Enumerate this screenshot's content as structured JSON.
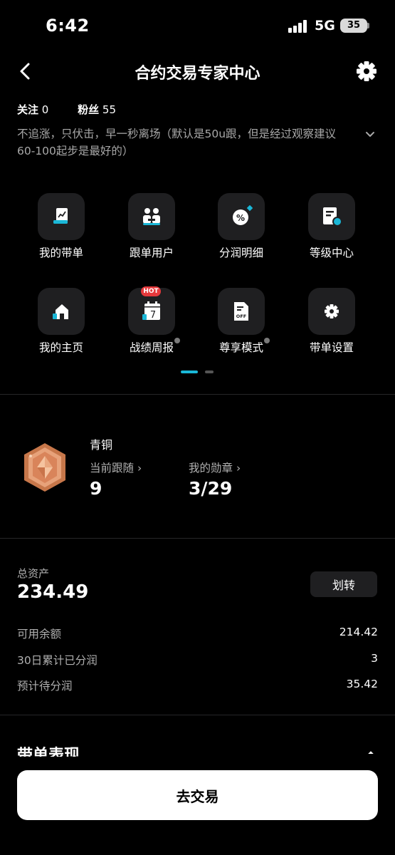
{
  "status_bar": {
    "time": "6:42",
    "network": "5G",
    "battery": "35"
  },
  "header": {
    "title": "合约交易专家中心"
  },
  "profile": {
    "follow_label": "关注",
    "follow_count": "0",
    "fans_label": "粉丝",
    "fans_count": "55",
    "bio": "不追涨，只伏击，早一秒离场（默认是50u跟，但是经过观察建议60-100起步是最好的）"
  },
  "grid": {
    "items": [
      {
        "label": "我的带单",
        "icon": "chart-doc-icon"
      },
      {
        "label": "跟单用户",
        "icon": "users-icon"
      },
      {
        "label": "分润明细",
        "icon": "percent-icon"
      },
      {
        "label": "等级中心",
        "icon": "level-icon"
      },
      {
        "label": "我的主页",
        "icon": "home-icon"
      },
      {
        "label": "战绩周报",
        "icon": "calendar-icon",
        "badge": "HOT",
        "calendar_day": "7"
      },
      {
        "label": "尊享模式",
        "icon": "coupon-icon",
        "icon_text": "OFF"
      },
      {
        "label": "带单设置",
        "icon": "gear-icon"
      }
    ]
  },
  "level": {
    "name": "青铜",
    "current_follow_label": "当前跟随",
    "current_follow_value": "9",
    "medals_label": "我的勋章",
    "medals_value": "3/29"
  },
  "assets": {
    "total_label": "总资产",
    "total_value": "234.49",
    "transfer_label": "划转",
    "rows": [
      {
        "label": "可用余额",
        "value": "214.42"
      },
      {
        "label": "30日累计已分润",
        "value": "3"
      },
      {
        "label": "预计待分润",
        "value": "35.42"
      }
    ]
  },
  "performance": {
    "title": "带单表现"
  },
  "actions": {
    "trade_label": "去交易"
  },
  "colors": {
    "accent": "#1ab7d7",
    "hot": "#e5393c",
    "bronze": "#d98a5a",
    "card": "#1f1f21"
  }
}
